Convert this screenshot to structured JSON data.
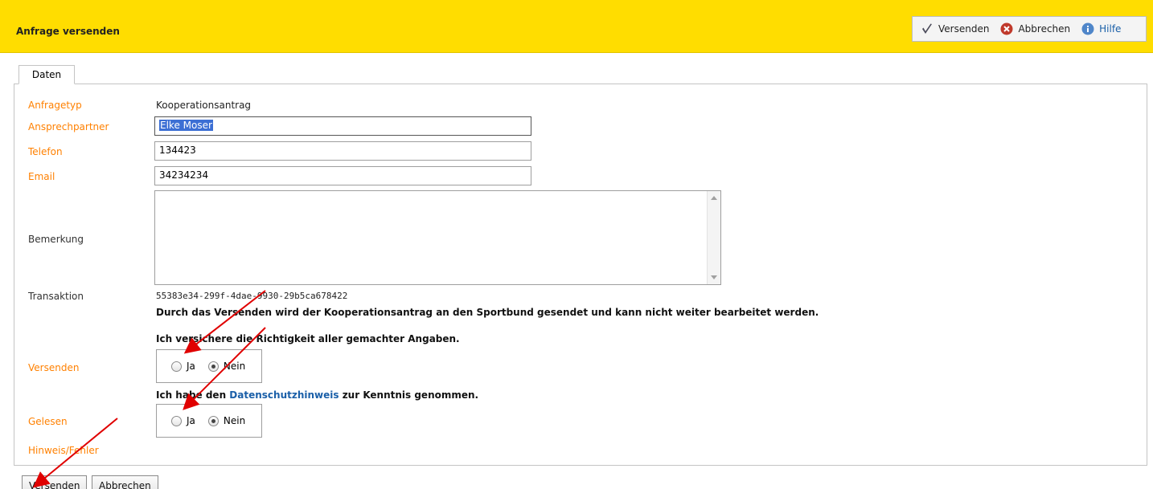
{
  "header": {
    "title": "Anfrage versenden",
    "toolbar": {
      "send_label": "Versenden",
      "cancel_label": "Abbrechen",
      "help_label": "Hilfe"
    }
  },
  "tab": {
    "label": "Daten"
  },
  "form": {
    "anfragetyp": {
      "label": "Anfragetyp",
      "value": "Kooperationsantrag"
    },
    "ansprechpartner": {
      "label": "Ansprechpartner",
      "value": "Elke Moser"
    },
    "telefon": {
      "label": "Telefon",
      "value": "134423"
    },
    "email": {
      "label": "Email",
      "value": "34234234"
    },
    "bemerkung": {
      "label": "Bemerkung",
      "value": ""
    },
    "transaktion": {
      "label": "Transaktion",
      "value": "55383e34-299f-4dae-9930-29b5ca678422"
    },
    "notice": "Durch das Versenden wird der Kooperationsantrag an den Sportbund gesendet und kann nicht weiter bearbeitet werden.",
    "assurance": "Ich versichere die Richtigkeit aller gemachter Angaben.",
    "versenden": {
      "label": "Versenden",
      "option_yes": "Ja",
      "option_no": "Nein",
      "selected": "Nein"
    },
    "privacy": {
      "prefix": "Ich habe den ",
      "link": "Datenschutzhinweis",
      "suffix": " zur Kenntnis genommen."
    },
    "gelesen": {
      "label": "Gelesen",
      "option_yes": "Ja",
      "option_no": "Nein",
      "selected": "Nein"
    },
    "hinweis": {
      "label": "Hinweis/Fehler"
    }
  },
  "buttons": {
    "send_label": "Versenden",
    "cancel_label": "Abbrechen"
  },
  "colors": {
    "header_bg": "#ffdd00",
    "label": "#ff8000",
    "link": "#1a5fa8",
    "annotation_arrow": "#e00000"
  },
  "icons": {
    "send": "checkmark-icon",
    "cancel": "cancel-circle-icon",
    "help": "info-icon"
  }
}
